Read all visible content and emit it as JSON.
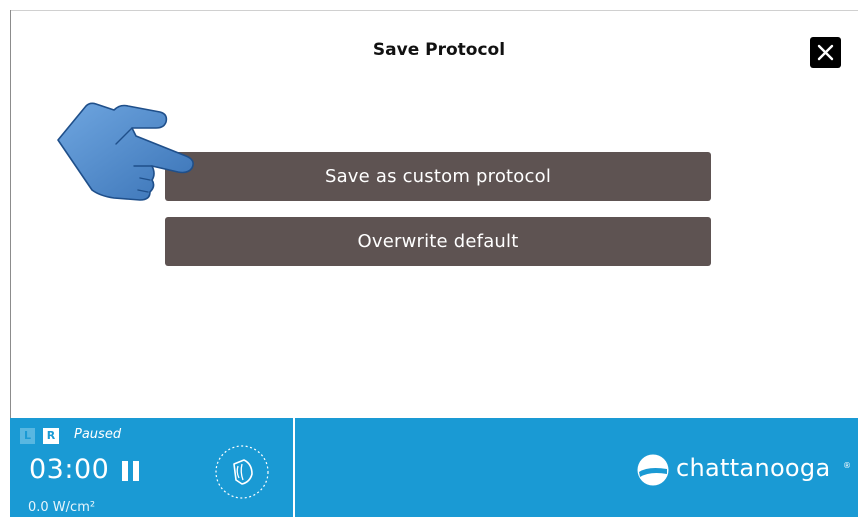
{
  "dialog": {
    "title": "Save Protocol",
    "close_icon": "close-icon"
  },
  "actions": {
    "save_custom_label": "Save as custom protocol",
    "overwrite_default_label": "Overwrite default"
  },
  "tutorial": {
    "pointer_icon": "pointing-hand-icon"
  },
  "footer": {
    "side_left": "L",
    "side_right": "R",
    "status": "Paused",
    "timer": "03:00",
    "pause_icon": "pause-icon",
    "intensity": "0.0 W/cm²",
    "applicator_icon": "ultrasound-applicator-icon",
    "brand": "chattanooga",
    "brand_mark": "®"
  },
  "colors": {
    "button_bg": "#5e5352",
    "footer_bg": "#1a9ad4",
    "close_bg": "#000000",
    "hand": "#4a86c8"
  }
}
